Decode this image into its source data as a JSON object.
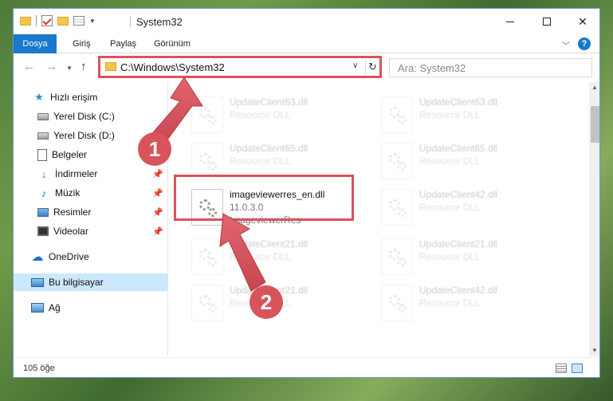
{
  "window": {
    "title": "System32"
  },
  "ribbon": {
    "tabs": [
      "Dosya",
      "Giriş",
      "Paylaş",
      "Görünüm"
    ],
    "help": "?"
  },
  "nav": {
    "address": "C:\\Windows\\System32",
    "search_placeholder": "Ara: System32"
  },
  "sidebar": {
    "items": [
      {
        "label": "Hızlı erişim",
        "icon": "star-icon"
      },
      {
        "label": "Yerel Disk (C:)",
        "icon": "drive-icon",
        "pinned": true
      },
      {
        "label": "Yerel Disk (D:)",
        "icon": "drive-icon",
        "pinned": true
      },
      {
        "label": "Belgeler",
        "icon": "document-icon",
        "pinned": true
      },
      {
        "label": "İndirmeler",
        "icon": "download-icon",
        "pinned": true
      },
      {
        "label": "Müzik",
        "icon": "music-icon",
        "pinned": true
      },
      {
        "label": "Resimler",
        "icon": "pictures-icon",
        "pinned": true
      },
      {
        "label": "Videolar",
        "icon": "video-icon",
        "pinned": true
      },
      {
        "label": "OneDrive",
        "icon": "cloud-icon"
      },
      {
        "label": "Bu bilgisayar",
        "icon": "computer-icon",
        "selected": true
      },
      {
        "label": "Ağ",
        "icon": "network-icon"
      }
    ]
  },
  "files": {
    "highlighted": {
      "name": "imageviewerres_en.dll",
      "version": "11.0.3.0",
      "description": "ImageviewerRes"
    },
    "faded": [
      {
        "name": "UpdateClient63.dll",
        "type": "Resource DLL"
      },
      {
        "name": "UpdateClient63.dll",
        "type": "Resource DLL"
      },
      {
        "name": "UpdateClient65.dll",
        "type": "Resource DLL"
      },
      {
        "name": "UpdateClient65.dll",
        "type": "Resource DLL"
      },
      {
        "name": "UpdateClient42.dll",
        "type": "Resource DLL"
      },
      {
        "name": "UpdateClient21.dll",
        "type": "Resource DLL"
      },
      {
        "name": "UpdateClient21.dll",
        "type": "Resource DLL"
      },
      {
        "name": "UpdateClient21.dll",
        "type": "Resource DLL"
      },
      {
        "name": "UpdateClient42.dll",
        "type": "Resource DLL"
      }
    ]
  },
  "status": {
    "count": "105 öğe"
  },
  "annotations": {
    "step1": "1",
    "step2": "2",
    "color": "#d9535b"
  }
}
